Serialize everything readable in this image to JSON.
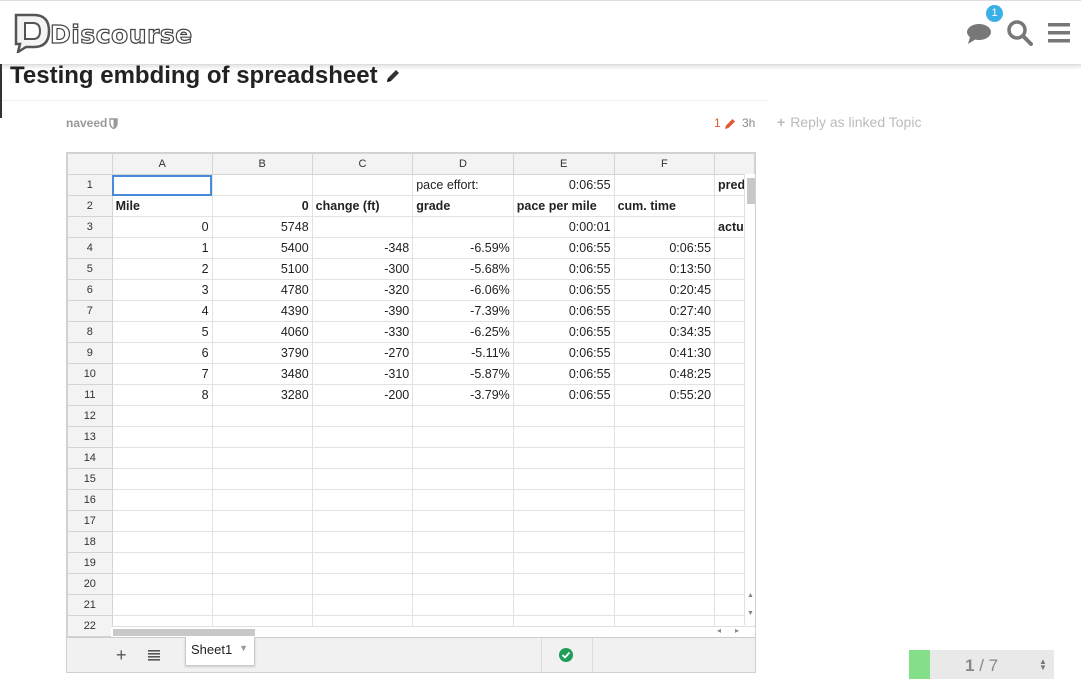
{
  "app": {
    "name": "Discourse",
    "notification_count": "1"
  },
  "topic": {
    "title": "Testing embding of spreadsheet",
    "author": "naveed",
    "edit_count": "1",
    "age": "3h",
    "reply_linked_label": "Reply as linked Topic"
  },
  "spreadsheet": {
    "column_headers": [
      "A",
      "B",
      "C",
      "D",
      "E",
      "F",
      ""
    ],
    "rows": [
      [
        "1",
        "",
        "",
        "",
        "pace effort:",
        "0:06:55",
        "",
        "pred"
      ],
      [
        "2",
        "Mile",
        "0",
        "change (ft)",
        "grade",
        "pace per mile",
        "cum. time",
        ""
      ],
      [
        "3",
        "0",
        "5748",
        "",
        "",
        "0:00:01",
        "",
        "actu"
      ],
      [
        "4",
        "1",
        "5400",
        "-348",
        "-6.59%",
        "0:06:55",
        "0:06:55",
        ""
      ],
      [
        "5",
        "2",
        "5100",
        "-300",
        "-5.68%",
        "0:06:55",
        "0:13:50",
        ""
      ],
      [
        "6",
        "3",
        "4780",
        "-320",
        "-6.06%",
        "0:06:55",
        "0:20:45",
        ""
      ],
      [
        "7",
        "4",
        "4390",
        "-390",
        "-7.39%",
        "0:06:55",
        "0:27:40",
        ""
      ],
      [
        "8",
        "5",
        "4060",
        "-330",
        "-6.25%",
        "0:06:55",
        "0:34:35",
        ""
      ],
      [
        "9",
        "6",
        "3790",
        "-270",
        "-5.11%",
        "0:06:55",
        "0:41:30",
        ""
      ],
      [
        "10",
        "7",
        "3480",
        "-310",
        "-5.87%",
        "0:06:55",
        "0:48:25",
        ""
      ],
      [
        "11",
        "8",
        "3280",
        "-200",
        "-3.79%",
        "0:06:55",
        "0:55:20",
        ""
      ],
      [
        "12",
        "",
        "",
        "",
        "",
        "",
        "",
        ""
      ],
      [
        "13",
        "",
        "",
        "",
        "",
        "",
        "",
        ""
      ],
      [
        "14",
        "",
        "",
        "",
        "",
        "",
        "",
        ""
      ],
      [
        "15",
        "",
        "",
        "",
        "",
        "",
        "",
        ""
      ],
      [
        "16",
        "",
        "",
        "",
        "",
        "",
        "",
        ""
      ],
      [
        "17",
        "",
        "",
        "",
        "",
        "",
        "",
        ""
      ],
      [
        "18",
        "",
        "",
        "",
        "",
        "",
        "",
        ""
      ],
      [
        "19",
        "",
        "",
        "",
        "",
        "",
        "",
        ""
      ],
      [
        "20",
        "",
        "",
        "",
        "",
        "",
        "",
        ""
      ],
      [
        "21",
        "",
        "",
        "",
        "",
        "",
        "",
        ""
      ],
      [
        "22",
        "",
        "",
        "",
        "",
        "",
        "",
        ""
      ]
    ],
    "sheet_tab": "Sheet1"
  },
  "progress": {
    "current": "1",
    "separator": "/",
    "total": "7",
    "fraction": 0.143
  },
  "colors": {
    "accent": "#3ab0e6",
    "progress": "#84e088",
    "edit": "#e45735",
    "ok": "#1e9e57"
  }
}
